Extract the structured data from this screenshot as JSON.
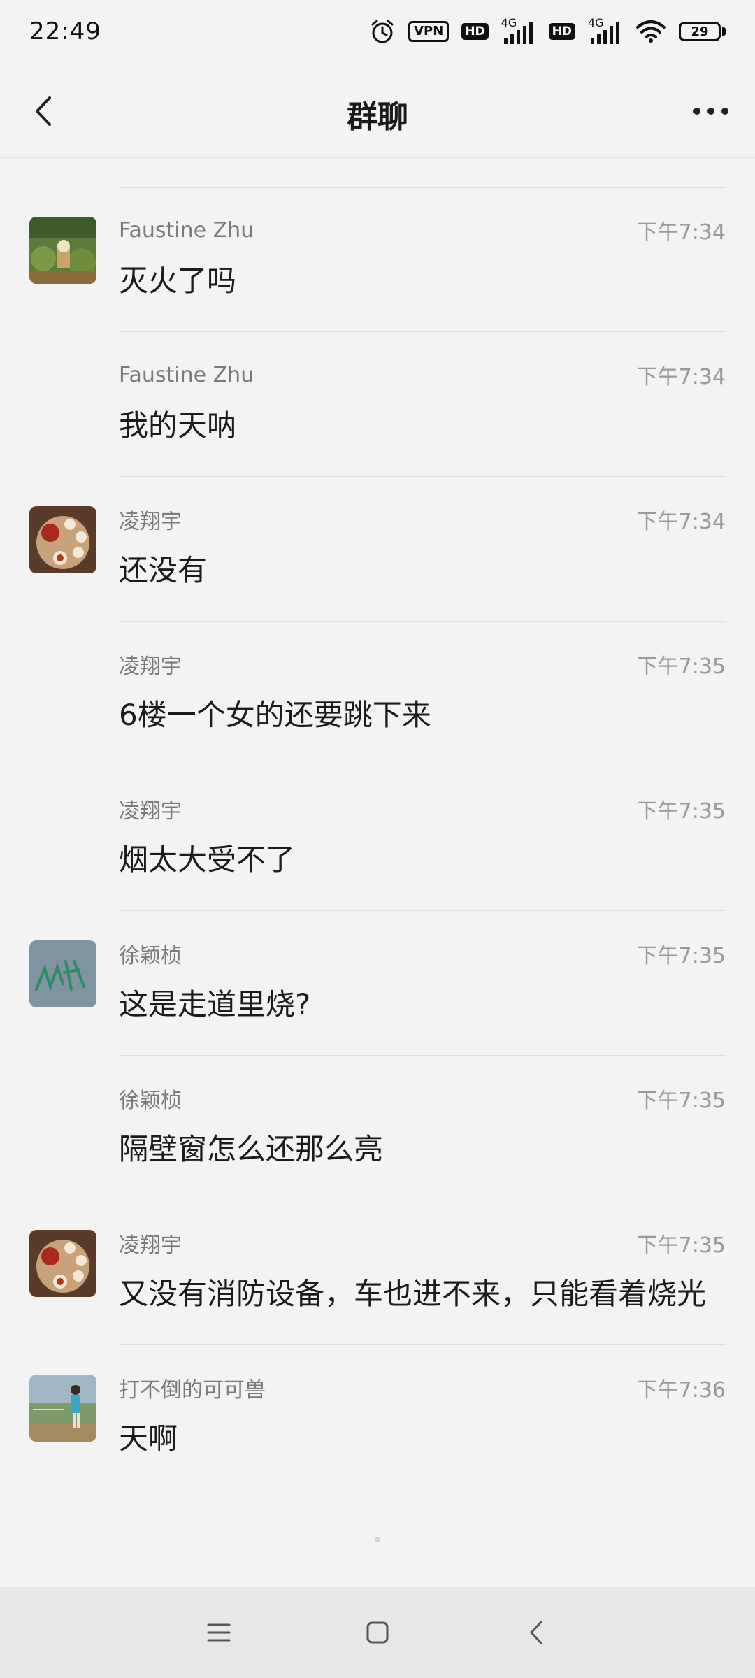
{
  "status_bar": {
    "time": "22:49",
    "vpn_label": "VPN",
    "hd1_label": "HD",
    "net1_label": "4G",
    "hd2_label": "HD",
    "net2_label": "4G",
    "battery_level": "29",
    "icons": [
      "alarm-icon",
      "vpn-icon",
      "hd-icon",
      "signal-icon",
      "hd-icon",
      "signal-icon",
      "wifi-icon",
      "battery-icon"
    ]
  },
  "header": {
    "title": "群聊",
    "back_icon": "chevron-left-icon",
    "more_icon": "more-horizontal-icon"
  },
  "messages": [
    {
      "sender": "Faustine Zhu",
      "time": "下午7:34",
      "text": "灭火了吗",
      "avatar": "landscape-photo"
    },
    {
      "sender": "Faustine Zhu",
      "time": "下午7:34",
      "text": "我的天呐",
      "avatar": ""
    },
    {
      "sender": "凌翔宇",
      "time": "下午7:34",
      "text": "还没有",
      "avatar": "tea-set-photo"
    },
    {
      "sender": "凌翔宇",
      "time": "下午7:35",
      "text": "6楼一个女的还要跳下来",
      "avatar": ""
    },
    {
      "sender": "凌翔宇",
      "time": "下午7:35",
      "text": "烟太大受不了",
      "avatar": ""
    },
    {
      "sender": "徐颖桢",
      "time": "下午7:35",
      "text": "这是走道里烧?",
      "avatar": "signature-drawing"
    },
    {
      "sender": "徐颖桢",
      "time": "下午7:35",
      "text": "隔壁窗怎么还那么亮",
      "avatar": ""
    },
    {
      "sender": "凌翔宇",
      "time": "下午7:35",
      "text": "又没有消防设备，车也进不来，只能看着烧光",
      "avatar": "tea-set-photo"
    },
    {
      "sender": "打不倒的可可兽",
      "time": "下午7:36",
      "text": "天啊",
      "avatar": "outdoor-person-photo"
    }
  ],
  "bottom_nav": {
    "items": [
      "menu-icon",
      "home-square-icon",
      "back-chevron-icon"
    ]
  }
}
